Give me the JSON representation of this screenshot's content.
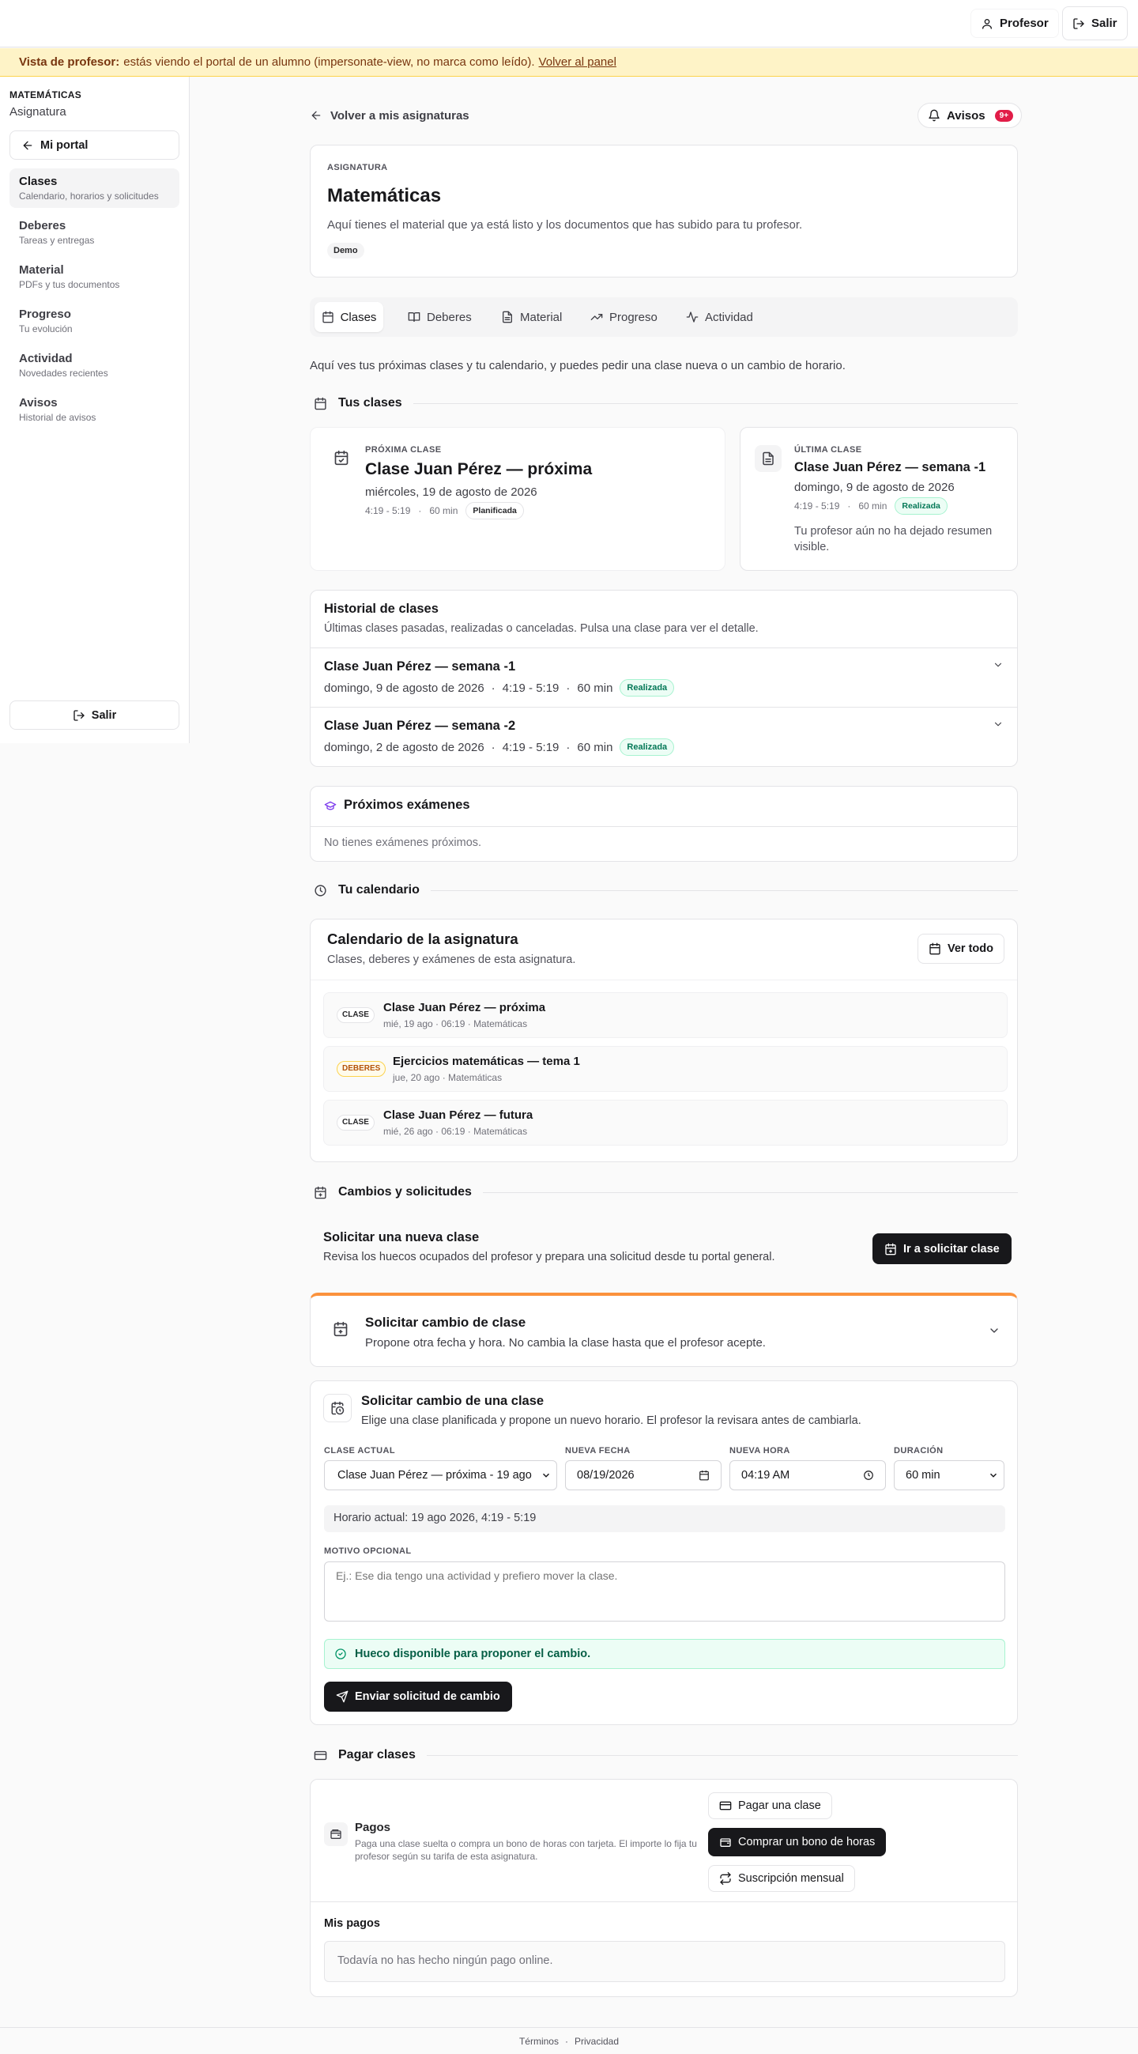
{
  "topbar": {
    "user_label": "Profesor",
    "logout_label": "Salir"
  },
  "banner": {
    "strong": "Vista de profesor:",
    "text": "estás viendo el portal de un alumno (impersonate-view, no marca como leído).",
    "link": "Volver al panel"
  },
  "sidebar": {
    "subject": "MATEMÁTICAS",
    "subtitle": "Asignatura",
    "portal_button": "Mi portal",
    "items": [
      {
        "label": "Clases",
        "desc": "Calendario, horarios y solicitudes"
      },
      {
        "label": "Deberes",
        "desc": "Tareas y entregas"
      },
      {
        "label": "Material",
        "desc": "PDFs y tus documentos"
      },
      {
        "label": "Progreso",
        "desc": "Tu evolución"
      },
      {
        "label": "Actividad",
        "desc": "Novedades recientes"
      },
      {
        "label": "Avisos",
        "desc": "Historial de avisos"
      }
    ],
    "logout_label": "Salir"
  },
  "nav": {
    "back": "Volver a mis asignaturas",
    "avisos": "Avisos",
    "avisos_count": "9+"
  },
  "subject_card": {
    "eyebrow": "ASIGNATURA",
    "title": "Matemáticas",
    "desc": "Aquí tienes el material que ya está listo y los documentos que has subido para tu profesor.",
    "tag": "Demo"
  },
  "tabs": [
    "Clases",
    "Deberes",
    "Material",
    "Progreso",
    "Actividad"
  ],
  "intro": "Aquí ves tus próximas clases y tu calendario, y puedes pedir una clase nueva o un cambio de horario.",
  "tus_clases": {
    "heading": "Tus clases",
    "next": {
      "eyebrow": "PRÓXIMA CLASE",
      "title": "Clase Juan Pérez — próxima",
      "date": "miércoles, 19 de agosto de 2026",
      "time": "4:19 - 5:19",
      "duration": "60 min",
      "status": "Planificada"
    },
    "last": {
      "eyebrow": "ÚLTIMA CLASE",
      "title": "Clase Juan Pérez — semana -1",
      "date": "domingo, 9 de agosto de 2026",
      "time": "4:19 - 5:19",
      "duration": "60 min",
      "status": "Realizada",
      "summary": "Tu profesor aún no ha dejado resumen visible."
    }
  },
  "history": {
    "title": "Historial de clases",
    "desc": "Últimas clases pasadas, realizadas o canceladas. Pulsa una clase para ver el detalle.",
    "rows": [
      {
        "title": "Clase Juan Pérez — semana -1",
        "date": "domingo, 9 de agosto de 2026",
        "time": "4:19 - 5:19",
        "duration": "60 min",
        "status": "Realizada"
      },
      {
        "title": "Clase Juan Pérez — semana -2",
        "date": "domingo, 2 de agosto de 2026",
        "time": "4:19 - 5:19",
        "duration": "60 min",
        "status": "Realizada"
      }
    ]
  },
  "exams": {
    "title": "Próximos exámenes",
    "empty": "No tienes exámenes próximos."
  },
  "calendar": {
    "heading": "Tu calendario",
    "title": "Calendario de la asignatura",
    "desc": "Clases, deberes y exámenes de esta asignatura.",
    "view_all": "Ver todo",
    "items": [
      {
        "tag": "CLASE",
        "title": "Clase Juan Pérez — próxima",
        "sub": "mié, 19 ago · 06:19 · Matemáticas"
      },
      {
        "tag": "DEBERES",
        "title": "Ejercicios matemáticas — tema 1",
        "sub": "jue, 20 ago · Matemáticas"
      },
      {
        "tag": "CLASE",
        "title": "Clase Juan Pérez — futura",
        "sub": "mié, 26 ago · 06:19 · Matemáticas"
      }
    ]
  },
  "changes": {
    "heading": "Cambios y solicitudes",
    "new_class": {
      "title": "Solicitar una nueva clase",
      "desc": "Revisa los huecos ocupados del profesor y prepara una solicitud desde tu portal general.",
      "button": "Ir a solicitar clase"
    },
    "change_collapsed": {
      "title": "Solicitar cambio de clase",
      "desc": "Propone otra fecha y hora. No cambia la clase hasta que el profesor acepte."
    },
    "form": {
      "title": "Solicitar cambio de una clase",
      "desc": "Elige una clase planificada y propone un nuevo horario. El profesor la revisara antes de cambiarla.",
      "labels": {
        "current": "CLASE ACTUAL",
        "date": "NUEVA FECHA",
        "time": "NUEVA HORA",
        "duration": "DURACIÓN",
        "reason": "MOTIVO OPCIONAL"
      },
      "current_value": "Clase Juan Pérez — próxima - 19 ago",
      "date_value": "08/19/2026",
      "time_value": "04:19 AM",
      "duration_value": "60 min",
      "schedule": "Horario actual: 19 ago 2026, 4:19 - 5:19",
      "reason_placeholder": "Ej.: Ese dia tengo una actividad y prefiero mover la clase.",
      "available": "Hueco disponible para proponer el cambio.",
      "submit": "Enviar solicitud de cambio"
    }
  },
  "payments": {
    "heading": "Pagar clases",
    "title": "Pagos",
    "desc": "Paga una clase suelta o compra un bono de horas con tarjeta. El importe lo fija tu profesor según su tarifa de esta asignatura.",
    "pay_one": "Pagar una clase",
    "buy_bundle": "Comprar un bono de horas",
    "monthly": "Suscripción mensual",
    "mine_title": "Mis pagos",
    "mine_empty": "Todavía no has hecho ningún pago online."
  },
  "footer": {
    "terms": "Términos",
    "sep": "·",
    "privacy": "Privacidad"
  }
}
